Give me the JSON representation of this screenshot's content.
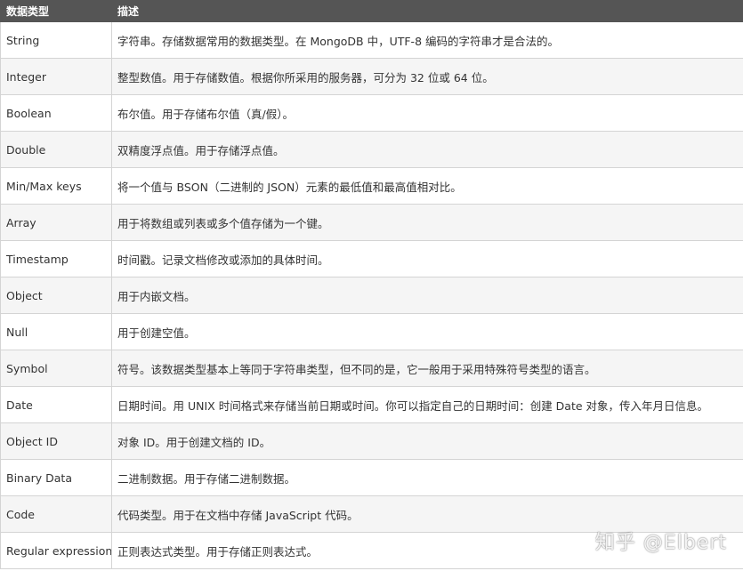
{
  "table": {
    "headers": [
      "数据类型",
      "描述"
    ],
    "rows": [
      {
        "type": "String",
        "desc": "字符串。存储数据常用的数据类型。在 MongoDB 中，UTF-8 编码的字符串才是合法的。"
      },
      {
        "type": "Integer",
        "desc": "整型数值。用于存储数值。根据你所采用的服务器，可分为 32 位或 64 位。"
      },
      {
        "type": "Boolean",
        "desc": "布尔值。用于存储布尔值（真/假）。"
      },
      {
        "type": "Double",
        "desc": "双精度浮点值。用于存储浮点值。"
      },
      {
        "type": "Min/Max keys",
        "desc": "将一个值与 BSON（二进制的 JSON）元素的最低值和最高值相对比。"
      },
      {
        "type": "Array",
        "desc": "用于将数组或列表或多个值存储为一个键。"
      },
      {
        "type": "Timestamp",
        "desc": "时间戳。记录文档修改或添加的具体时间。"
      },
      {
        "type": "Object",
        "desc": "用于内嵌文档。"
      },
      {
        "type": "Null",
        "desc": "用于创建空值。"
      },
      {
        "type": "Symbol",
        "desc": "符号。该数据类型基本上等同于字符串类型，但不同的是，它一般用于采用特殊符号类型的语言。"
      },
      {
        "type": "Date",
        "desc": "日期时间。用 UNIX 时间格式来存储当前日期或时间。你可以指定自己的日期时间：创建 Date 对象，传入年月日信息。"
      },
      {
        "type": "Object ID",
        "desc": "对象 ID。用于创建文档的 ID。"
      },
      {
        "type": "Binary Data",
        "desc": "二进制数据。用于存储二进制数据。"
      },
      {
        "type": "Code",
        "desc": "代码类型。用于在文档中存储 JavaScript 代码。"
      },
      {
        "type": "Regular expression",
        "desc": "正则表达式类型。用于存储正则表达式。"
      }
    ]
  },
  "watermark": "知乎 @Elbert",
  "colors": {
    "header_bg": "#555555",
    "header_text": "#ffffff",
    "row_alt_bg": "#f5f5f5",
    "border": "#d4d4d4"
  }
}
